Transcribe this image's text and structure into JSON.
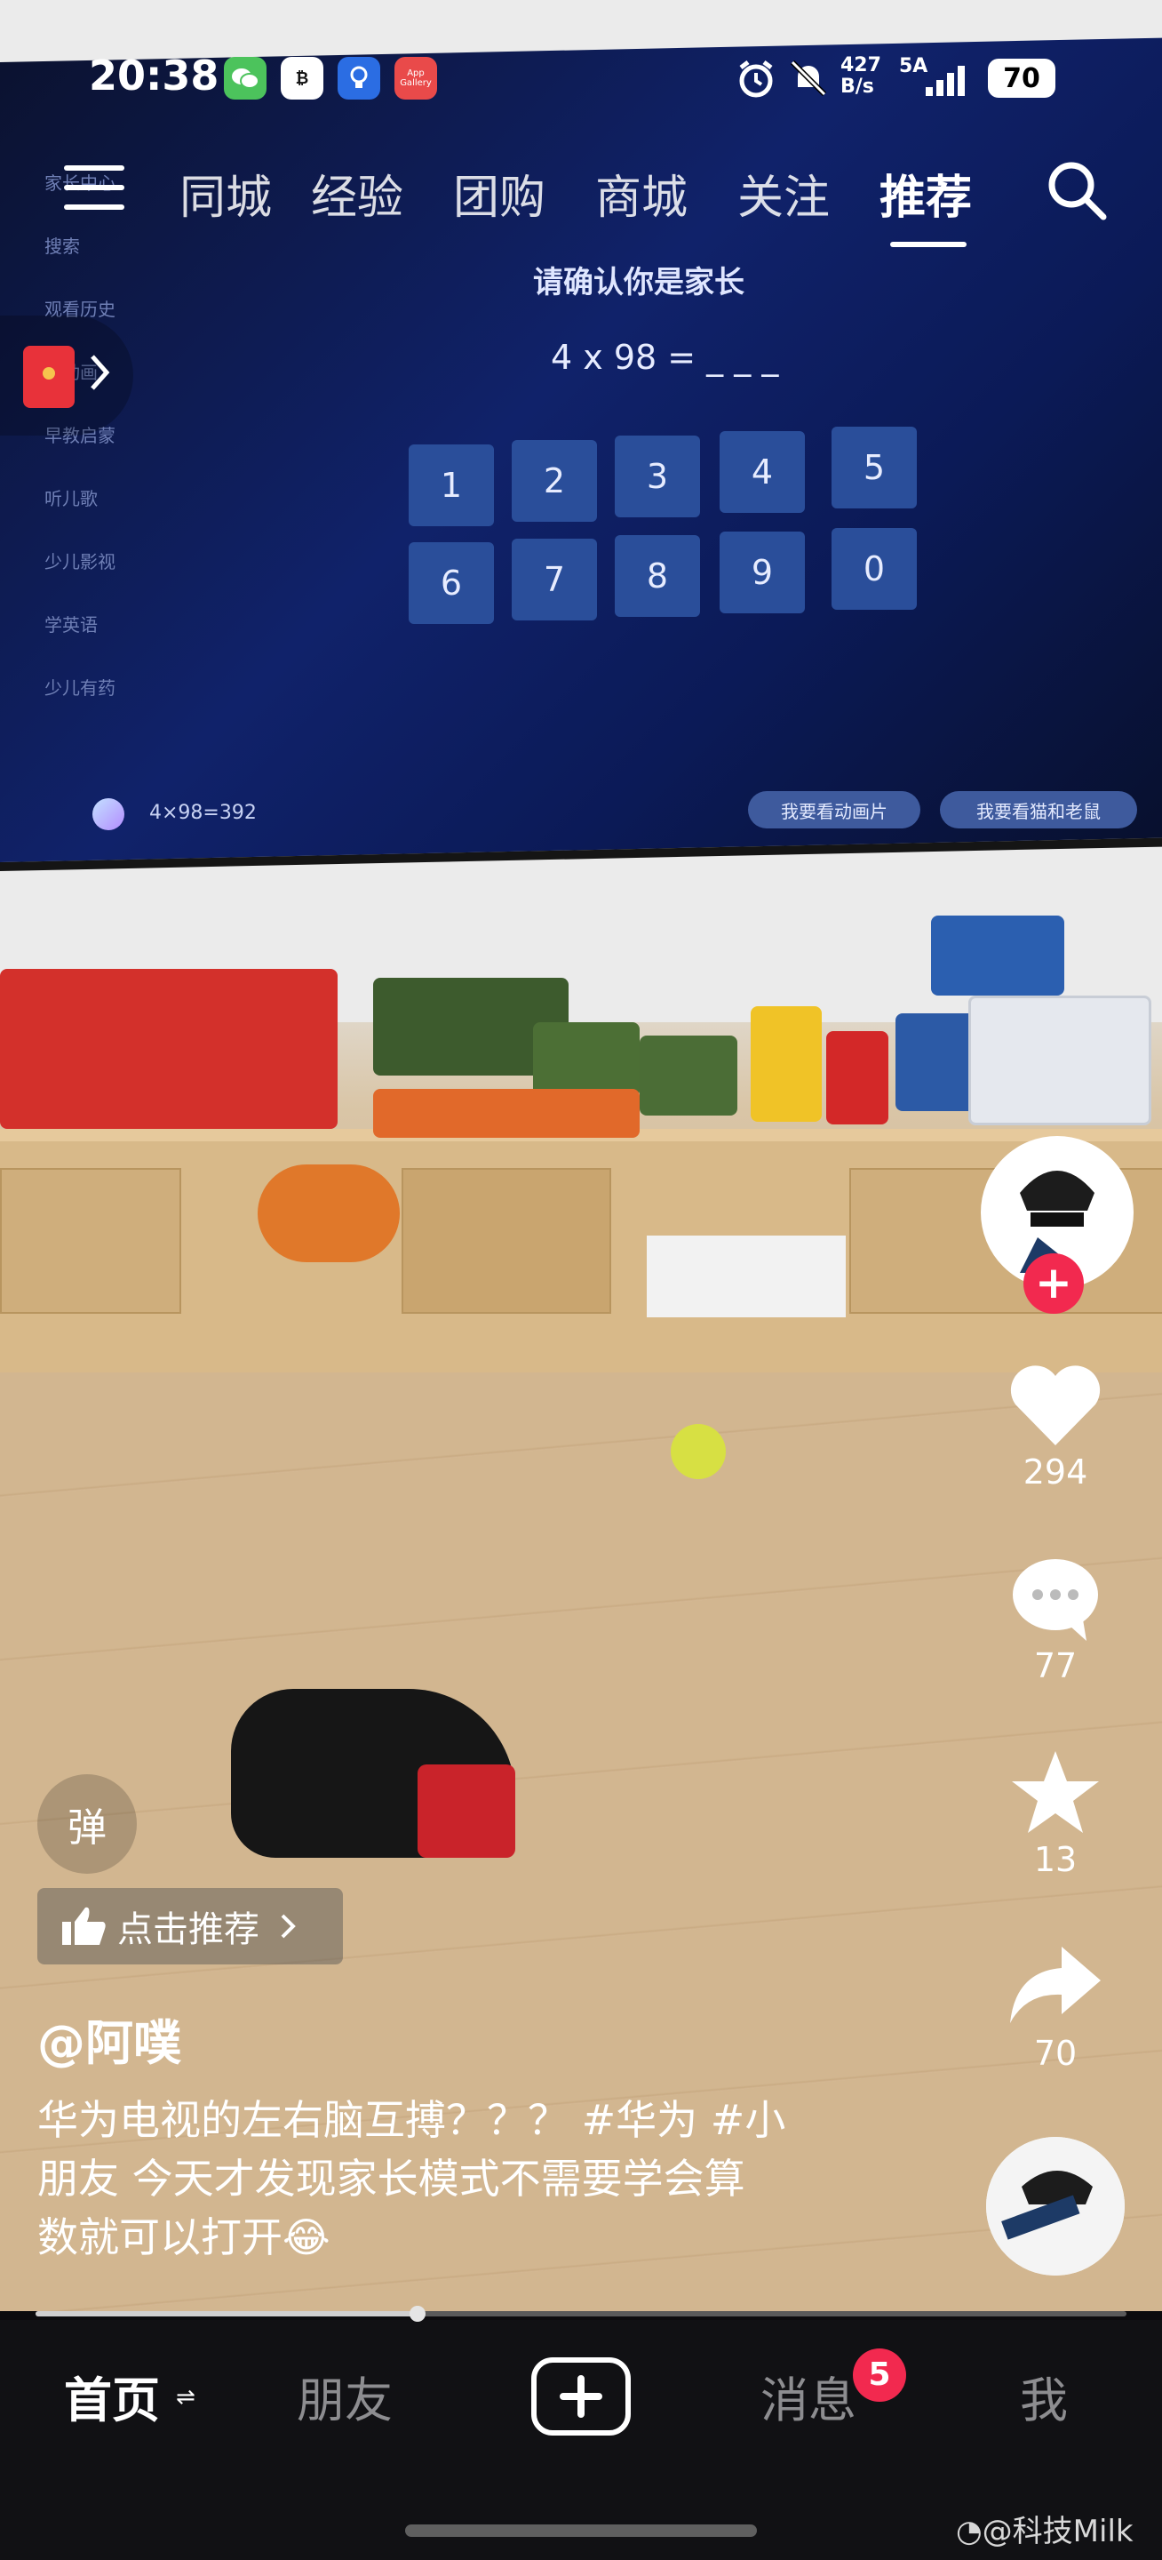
{
  "status_bar": {
    "time": "20:38",
    "app_gallery_label": "App Gallery",
    "net_speed_top": "427",
    "net_speed_unit": "B/s",
    "signal_label": "5A",
    "battery": "70"
  },
  "top_nav": {
    "tabs": [
      "同城",
      "经验",
      "团购",
      "商城",
      "关注",
      "推荐"
    ],
    "active_index": 5
  },
  "tv_screen": {
    "sidebar_items": [
      "家长中心",
      "搜索",
      "观看历史",
      "看动画",
      "早教启蒙",
      "听儿歌",
      "少儿影视",
      "学英语",
      "少儿有药"
    ],
    "prompt_title": "请确认你是家长",
    "equation": "4 x 98 = _ _ _",
    "keys": [
      "1",
      "2",
      "3",
      "4",
      "5",
      "6",
      "7",
      "8",
      "9",
      "0"
    ],
    "answer_text": "4×98=392",
    "button_left": "我要看动画片",
    "button_right": "我要看猫和老鼠"
  },
  "side_rail": {
    "like_count": "294",
    "comment_count": "77",
    "favorite_count": "13",
    "share_count": "70",
    "follow_symbol": "+"
  },
  "overlay": {
    "danmu_label": "弹",
    "recommend_label": "点击推荐",
    "author": "@阿噗",
    "caption_line1": "华为电视的左右脑互搏？？？ #华为 #小",
    "caption_line2": "朋友 今天才发现家长模式不需要学会算",
    "caption_line3": "数就可以打开😂"
  },
  "progress": {
    "fraction": 0.35
  },
  "bottom_nav": {
    "home": "首页",
    "friends": "朋友",
    "messages": "消息",
    "messages_badge": "5",
    "me": "我"
  },
  "watermark": "@科技Milk",
  "colors": {
    "accent_red": "#f2294f",
    "tv_blue": "#10226a"
  }
}
